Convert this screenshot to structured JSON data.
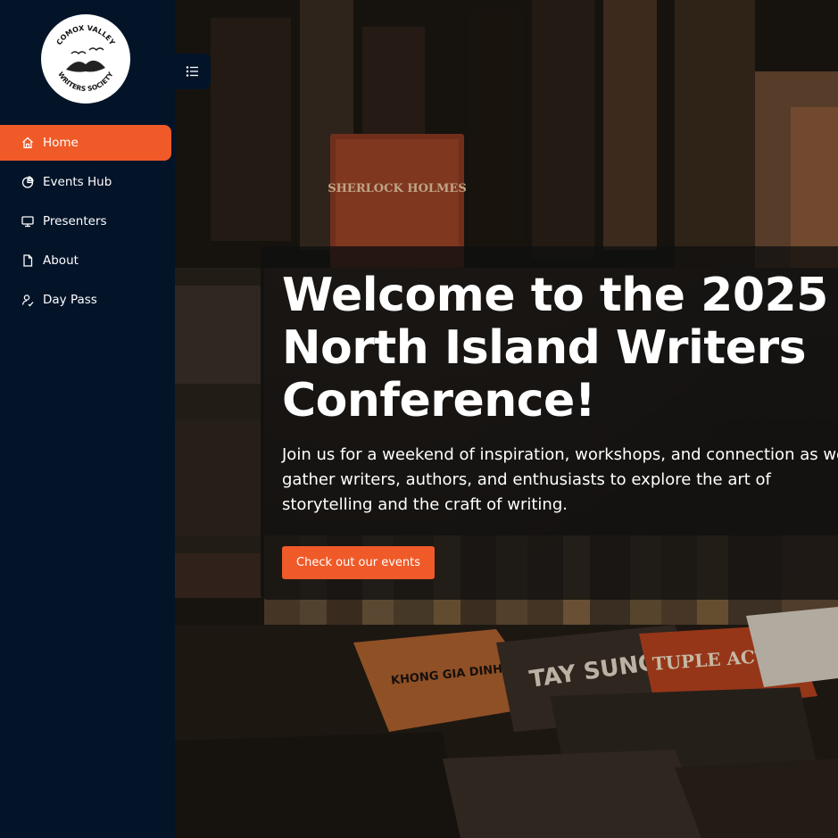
{
  "logo": {
    "alt": "Comox Valley Writers Society",
    "text_top": "COMOX VALLEY",
    "text_bottom": "WRITERS SOCIETY"
  },
  "sidebar": {
    "items": [
      {
        "label": "Home",
        "icon": "home-icon",
        "active": true
      },
      {
        "label": "Events Hub",
        "icon": "pie-chart-icon",
        "active": false
      },
      {
        "label": "Presenters",
        "icon": "monitor-icon",
        "active": false
      },
      {
        "label": "About",
        "icon": "document-icon",
        "active": false
      },
      {
        "label": "Day Pass",
        "icon": "user-pass-icon",
        "active": false
      }
    ]
  },
  "toggle": {
    "icon": "menu-list-icon"
  },
  "hero": {
    "title": "Welcome to the 2025 North Island Writers Conference!",
    "subtitle": "Join us for a weekend of inspiration, workshops, and connection as we gather writers, authors, and enthusiasts to explore the art of storytelling and the craft of writing.",
    "cta_label": "Check out our events"
  },
  "background": {
    "description_icon": "bookshelf-background-image",
    "book_titles": [
      "SHERLOCK HOLMES",
      "KHONG GIA DINH",
      "TAY SUNG",
      "TUPLE ACTOM"
    ]
  },
  "colors": {
    "sidebar_bg": "#031429",
    "accent": "#f05a28",
    "text_light": "#ffffff"
  }
}
